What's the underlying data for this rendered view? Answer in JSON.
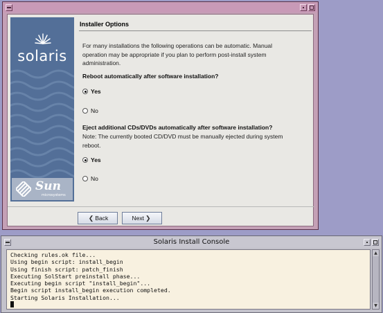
{
  "installer": {
    "heading": "Installer Options",
    "intro": "For many installations the following operations can be automatic.  Manual operation may be appropriate if you plan to perform post-install system administration.",
    "question1": {
      "label": "Reboot automatically after software installation?",
      "options": [
        "Yes",
        "No"
      ],
      "selected": "Yes"
    },
    "question2": {
      "label": "Eject additional CDs/DVDs automatically after software installation?",
      "note": "Note: The currently booted CD/DVD must be manually ejected during system reboot.",
      "options": [
        "Yes",
        "No"
      ],
      "selected": "Yes"
    },
    "buttons": {
      "back": "Back",
      "next": "Next"
    },
    "branding": {
      "product": "solaris",
      "company": "Sun",
      "company_sub": "microsystems"
    },
    "colors": {
      "frame": "#c4a0b6",
      "banner": "#536f98",
      "panel": "#e9e8e4"
    }
  },
  "console": {
    "title": "Solaris Install Console",
    "lines": [
      "Checking rules.ok file...",
      "Using begin script: install_begin",
      "Using finish script: patch_finish",
      "Executing SolStart preinstall phase...",
      "Executing begin script \"install_begin\"...",
      "Begin script install_begin execution completed.",
      "Starting Solaris Installation..."
    ],
    "colors": {
      "background": "#f8f1e0"
    }
  },
  "icons": [
    "window-menu-icon",
    "minimize-icon",
    "maximize-icon",
    "sun-rays-icon",
    "sun-logo-icon",
    "chevron-left-icon",
    "chevron-right-icon",
    "scroll-up-icon",
    "scroll-down-icon"
  ]
}
